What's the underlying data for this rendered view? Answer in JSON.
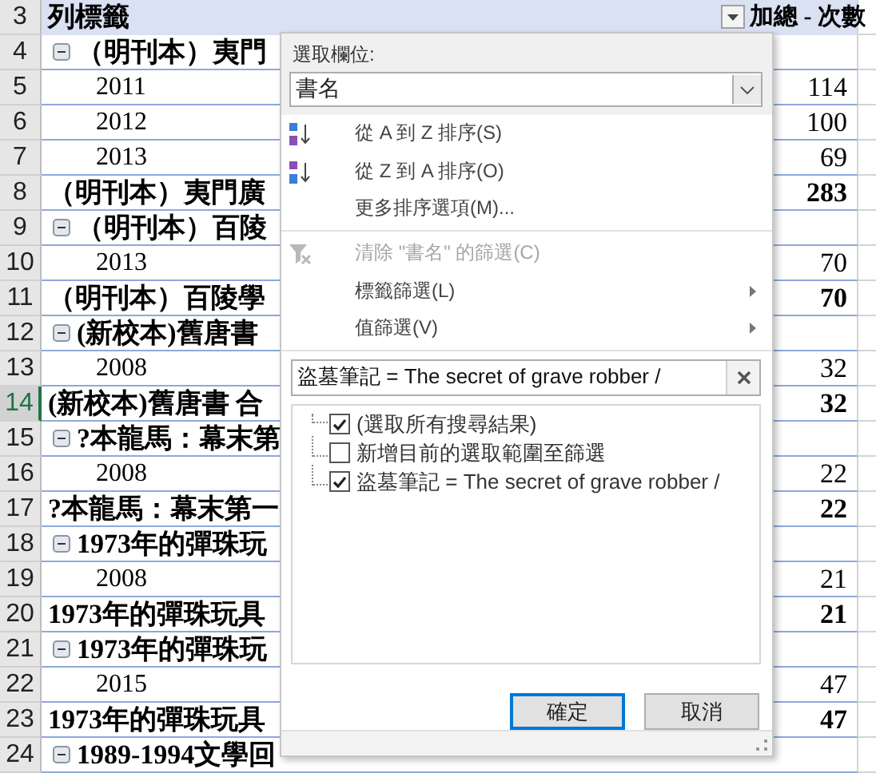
{
  "sheet": {
    "rows": [
      {
        "number": "3",
        "kind": "header",
        "label": "列標籤",
        "value": "加總 - 次數",
        "selected": false
      },
      {
        "number": "4",
        "kind": "group",
        "label": "（明刊本）夷門",
        "value": "",
        "selected": false
      },
      {
        "number": "5",
        "kind": "year",
        "label": "2011",
        "value": "114",
        "selected": false
      },
      {
        "number": "6",
        "kind": "year",
        "label": "2012",
        "value": "100",
        "selected": false
      },
      {
        "number": "7",
        "kind": "year",
        "label": "2013",
        "value": "69",
        "selected": false
      },
      {
        "number": "8",
        "kind": "total",
        "label": "（明刊本）夷門廣",
        "value": "283",
        "selected": false
      },
      {
        "number": "9",
        "kind": "group",
        "label": "（明刊本）百陵",
        "value": "",
        "selected": false
      },
      {
        "number": "10",
        "kind": "year",
        "label": "2013",
        "value": "70",
        "selected": false
      },
      {
        "number": "11",
        "kind": "total",
        "label": "（明刊本）百陵學",
        "value": "70",
        "selected": false
      },
      {
        "number": "12",
        "kind": "group",
        "label": "(新校本)舊唐書",
        "value": "",
        "selected": false
      },
      {
        "number": "13",
        "kind": "year",
        "label": "2008",
        "value": "32",
        "selected": false
      },
      {
        "number": "14",
        "kind": "total",
        "label": "(新校本)舊唐書 合",
        "value": "32",
        "selected": true
      },
      {
        "number": "15",
        "kind": "group",
        "label": "?本龍馬：幕末第",
        "value": "",
        "selected": false
      },
      {
        "number": "16",
        "kind": "year",
        "label": "2008",
        "value": "22",
        "selected": false
      },
      {
        "number": "17",
        "kind": "total",
        "label": "?本龍馬：幕末第一",
        "value": "22",
        "selected": false
      },
      {
        "number": "18",
        "kind": "group",
        "label": "1973年的彈珠玩",
        "value": "",
        "selected": false
      },
      {
        "number": "19",
        "kind": "year",
        "label": "2008",
        "value": "21",
        "selected": false
      },
      {
        "number": "20",
        "kind": "total",
        "label": "1973年的彈珠玩具",
        "value": "21",
        "selected": false
      },
      {
        "number": "21",
        "kind": "group",
        "label": "1973年的彈珠玩",
        "value": "",
        "selected": false
      },
      {
        "number": "22",
        "kind": "year",
        "label": "2015",
        "value": "47",
        "selected": false
      },
      {
        "number": "23",
        "kind": "total",
        "label": "1973年的彈珠玩具",
        "value": "47",
        "selected": false
      },
      {
        "number": "24",
        "kind": "group",
        "label": "1989-1994文學回",
        "value": "",
        "selected": false
      }
    ]
  },
  "filter_menu": {
    "field_label": "選取欄位:",
    "field_value": "書名",
    "items": [
      {
        "kind": "sort_asc",
        "label": "從 A 到 Z 排序(S)",
        "disabled": false
      },
      {
        "kind": "sort_desc",
        "label": "從 Z 到 A 排序(O)",
        "disabled": false
      },
      {
        "kind": "plain",
        "label": "更多排序選項(M)...",
        "disabled": false
      },
      {
        "kind": "clear",
        "label": "清除 \"書名\" 的篩選(C)",
        "disabled": true
      },
      {
        "kind": "submenu",
        "label": "標籤篩選(L)",
        "disabled": false
      },
      {
        "kind": "submenu",
        "label": "值篩選(V)",
        "disabled": false
      }
    ],
    "search": {
      "value": "盜墓筆記 = The secret of grave robber /"
    },
    "list": [
      {
        "label": "(選取所有搜尋結果)",
        "checked": true
      },
      {
        "label": "新增目前的選取範圍至篩選",
        "checked": false
      },
      {
        "label": "盜墓筆記 = The secret of grave robber /",
        "checked": true
      }
    ],
    "buttons": [
      {
        "label": "確定",
        "focused": true
      },
      {
        "label": "取消",
        "focused": false
      }
    ]
  }
}
